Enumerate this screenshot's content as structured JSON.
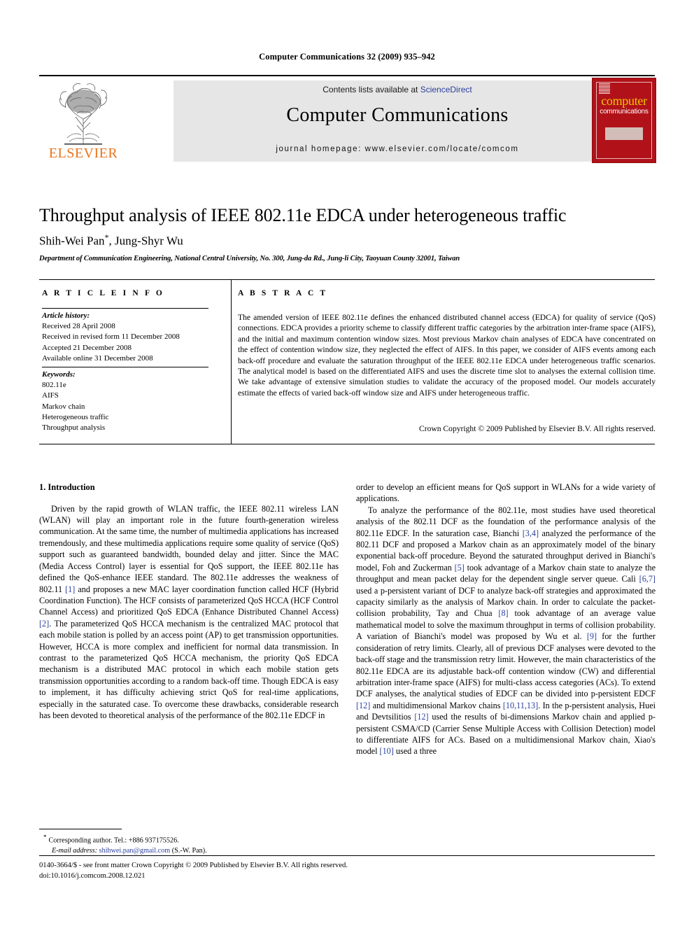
{
  "running_head": "Computer Communications 32 (2009) 935–942",
  "header": {
    "contents_prefix": "Contents lists available at",
    "sciencedirect": "ScienceDirect",
    "journal_title": "Computer Communications",
    "homepage": "journal homepage: www.elsevier.com/locate/comcom",
    "publisher_logo_text": "ELSEVIER",
    "publisher_logo_icon": "elsevier-tree-icon",
    "cover": {
      "line1": "computer",
      "line2": "communications",
      "color": "#b11219",
      "title_color": "#f2c200"
    }
  },
  "article": {
    "title": "Throughput analysis of IEEE 802.11e EDCA under heterogeneous traffic",
    "authors": "Shih-Wei Pan",
    "authors_tail": ", Jung-Shyr Wu",
    "corresponding_marker": "*",
    "affiliation": "Department of Communication Engineering, National Central University, No. 300, Jung-da Rd., Jung-li City, Taoyuan County 32001, Taiwan"
  },
  "article_info": {
    "heading": "A R T I C L E  I N F O",
    "history_label": "Article history:",
    "history": [
      "Received 28 April 2008",
      "Received in revised form 11 December 2008",
      "Accepted 21 December 2008",
      "Available online 31 December 2008"
    ],
    "keywords_label": "Keywords:",
    "keywords": [
      "802.11e",
      "AIFS",
      "Markov chain",
      "Heterogeneous traffic",
      "Throughput analysis"
    ]
  },
  "abstract": {
    "heading": "A B S T R A C T",
    "text": "The amended version of IEEE 802.11e defines the enhanced distributed channel access (EDCA) for quality of service (QoS) connections. EDCA provides a priority scheme to classify different traffic categories by the arbitration inter-frame space (AIFS), and the initial and maximum contention window sizes. Most previous Markov chain analyses of EDCA have concentrated on the effect of contention window size, they neglected the effect of AIFS. In this paper, we consider of AIFS events among each back-off procedure and evaluate the saturation throughput of the IEEE 802.11e EDCA under heterogeneous traffic scenarios. The analytical model is based on the differentiated AIFS and uses the discrete time slot to analyses the external collision time. We take advantage of extensive simulation studies to validate the accuracy of the proposed model. Our models accurately estimate the effects of varied back-off window size and AIFS under heterogeneous traffic.",
    "copyright": "Crown Copyright © 2009 Published by Elsevier B.V. All rights reserved."
  },
  "body": {
    "section_heading": "1. Introduction",
    "left_paragraph_1_a": "Driven by the rapid growth of WLAN traffic, the IEEE 802.11 wireless LAN (WLAN) will play an important role in the future fourth-generation wireless communication. At the same time, the number of multimedia applications has increased tremendously, and these multimedia applications require some quality of service (QoS) support such as guaranteed bandwidth, bounded delay and jitter. Since the MAC (Media Access Control) layer is essential for QoS support, the IEEE 802.11e has defined the QoS-enhance IEEE standard. The 802.11e addresses the weakness of 802.11 ",
    "cite_1": "[1]",
    "left_paragraph_1_b": " and proposes a new MAC layer coordination function called HCF (Hybrid Coordination Function). The HCF consists of parameterized QoS HCCA (HCF Control Channel Access) and prioritized QoS EDCA (Enhance Distributed Channel Access) ",
    "cite_2": "[2]",
    "left_paragraph_1_c": ". The parameterized QoS HCCA mechanism is the centralized MAC protocol that each mobile station is polled by an access point (AP) to get transmission opportunities. However, HCCA is more complex and inefficient for normal data transmission. In contrast to the parameterized QoS HCCA mechanism, the priority QoS EDCA mechanism is a distributed MAC protocol in which each mobile station gets transmission opportunities according to a random back-off time. Though EDCA is easy to implement, it has difficulty achieving strict QoS for real-time applications, especially in the saturated case. To overcome these drawbacks, considerable research has been devoted to theoretical analysis of the performance of the 802.11e EDCF in",
    "right_paragraph_1": "order to develop an efficient means for QoS support in WLANs for a wide variety of applications.",
    "right_paragraph_2_a": "To analyze the performance of the 802.11e, most studies have used theoretical analysis of the 802.11 DCF as the foundation of the performance analysis of the 802.11e EDCF. In the saturation case, Bianchi ",
    "cite_34": "[3,4]",
    "right_paragraph_2_b": " analyzed the performance of the 802.11 DCF and proposed a Markov chain as an approximately model of the binary exponential back-off procedure. Beyond the saturated throughput derived in Bianchi's model, Foh and Zuckerman ",
    "cite_5": "[5]",
    "right_paragraph_2_c": " took advantage of a Markov chain state to analyze the throughput and mean packet delay for the dependent single server queue. Calì ",
    "cite_67": "[6,7]",
    "right_paragraph_2_d": " used a p-persistent variant of DCF to analyze back-off strategies and approximated the capacity similarly as the analysis of Markov chain. In order to calculate the packet-collision probability, Tay and Chua ",
    "cite_8": "[8]",
    "right_paragraph_2_e": " took advantage of an average value mathematical model to solve the maximum throughput in terms of collision probability. A variation of Bianchi's model was proposed by Wu et al. ",
    "cite_9": "[9]",
    "right_paragraph_2_f": " for the further consideration of retry limits. Clearly, all of previous DCF analyses were devoted to the back-off stage and the transmission retry limit. However, the main characteristics of the 802.11e EDCA are its adjustable back-off contention window (CW) and differential arbitration inter-frame space (AIFS) for multi-class access categories (ACs). To extend DCF analyses, the analytical studies of EDCF can be divided into p-persistent EDCF ",
    "cite_12": "[12]",
    "right_paragraph_2_g": " and multidimensional Markov chains ",
    "cite_101113": "[10,11,13]",
    "right_paragraph_2_h": ". In the p-persistent analysis, Huei and Devtsilitios ",
    "cite_12b": "[12]",
    "right_paragraph_2_i": " used the results of bi-dimensions Markov chain and applied p-persistent CSMA/CD (Carrier Sense Multiple Access with Collision Detection) model to differentiate AIFS for ACs. Based on a multidimensional Markov chain, Xiao's model ",
    "cite_10": "[10]",
    "right_paragraph_2_j": " used a three"
  },
  "footnote": {
    "marker": "*",
    "corresponding": "Corresponding author. Tel.: +886 937175526.",
    "email_label": "E-mail address:",
    "email": "shihwei.pan@gmail.com",
    "email_suffix": "(S.-W. Pan)."
  },
  "legal": {
    "line1": "0140-3664/$ - see front matter Crown Copyright © 2009 Published by Elsevier B.V. All rights reserved.",
    "line2": "doi:10.1016/j.comcom.2008.12.021"
  }
}
